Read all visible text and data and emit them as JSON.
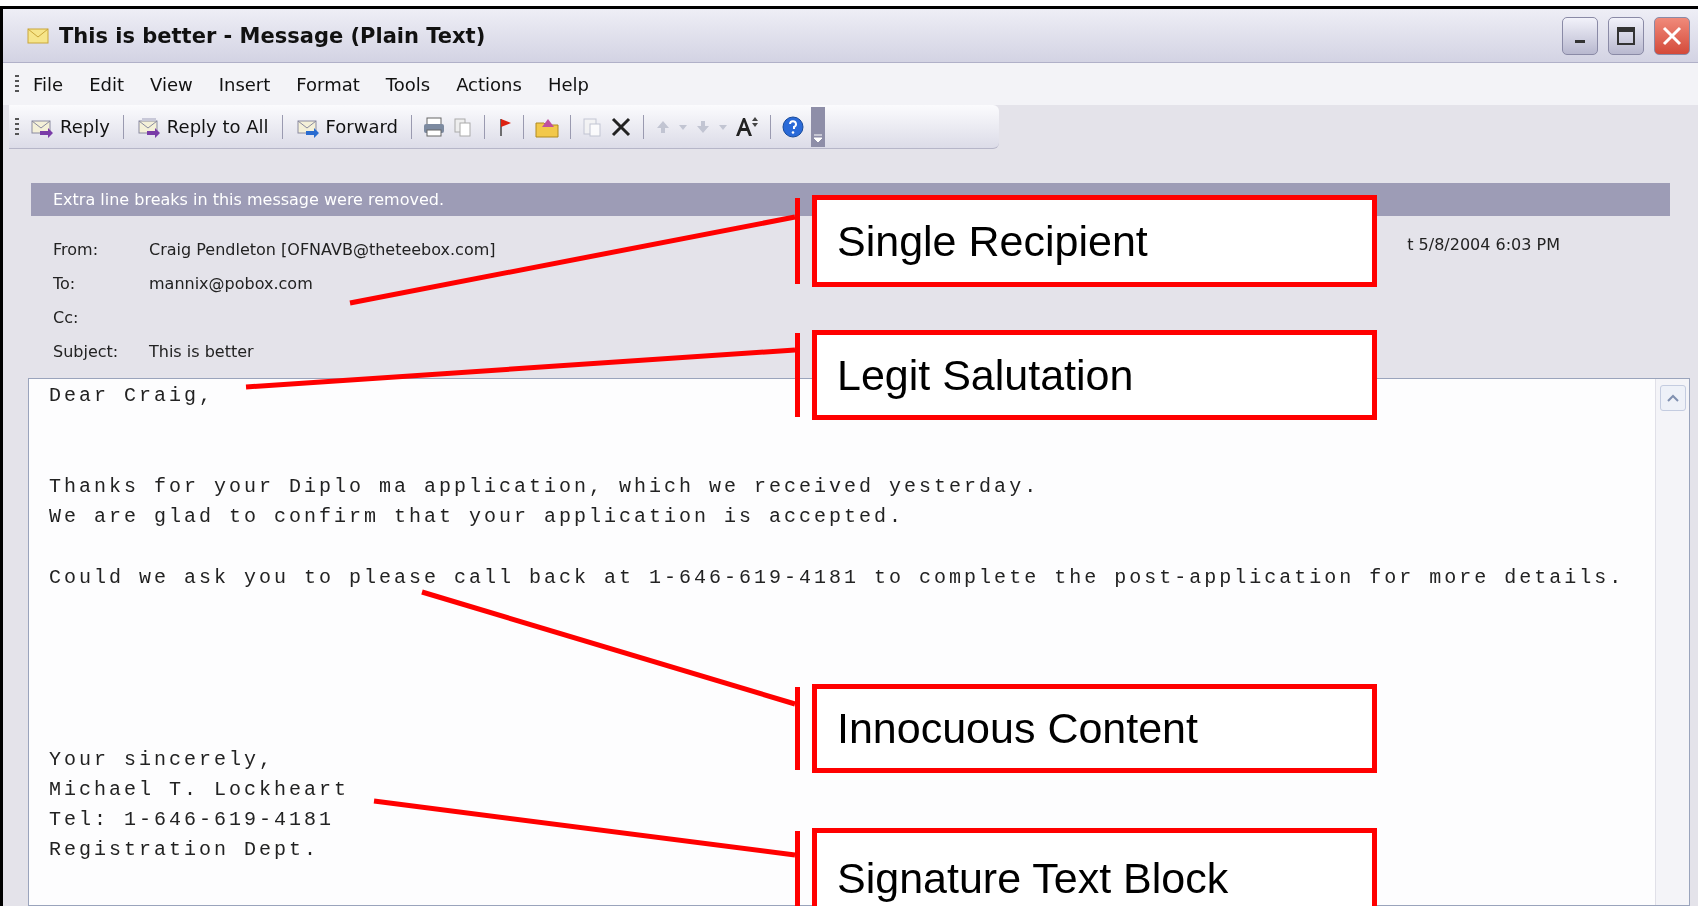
{
  "window": {
    "title": "This is better - Message (Plain Text)"
  },
  "menu": [
    {
      "label": "File"
    },
    {
      "label": "Edit"
    },
    {
      "label": "View"
    },
    {
      "label": "Insert"
    },
    {
      "label": "Format"
    },
    {
      "label": "Tools"
    },
    {
      "label": "Actions"
    },
    {
      "label": "Help"
    }
  ],
  "toolbar": [
    {
      "kind": "reply",
      "label": "Reply"
    },
    {
      "kind": "separator"
    },
    {
      "kind": "replyall",
      "label": "Reply to All"
    },
    {
      "kind": "separator"
    },
    {
      "kind": "forward",
      "label": "Forward"
    },
    {
      "kind": "separator"
    },
    {
      "kind": "print"
    },
    {
      "kind": "copy"
    },
    {
      "kind": "separator"
    },
    {
      "kind": "flag"
    },
    {
      "kind": "separator"
    },
    {
      "kind": "move"
    },
    {
      "kind": "separator"
    },
    {
      "kind": "paste",
      "disabled": true
    },
    {
      "kind": "delete"
    },
    {
      "kind": "separator"
    },
    {
      "kind": "previous",
      "disabled": true
    },
    {
      "kind": "dropdown",
      "disabled": true
    },
    {
      "kind": "next",
      "disabled": true
    },
    {
      "kind": "dropdown",
      "disabled": true
    },
    {
      "kind": "fontsize"
    },
    {
      "kind": "separator"
    },
    {
      "kind": "help"
    },
    {
      "kind": "overflow"
    }
  ],
  "info_bar": "Extra line breaks in this message were removed.",
  "header": [
    {
      "label": "From:",
      "value": "Craig Pendleton [OFNAVB@theteebox.com]"
    },
    {
      "label": "To:",
      "value": "mannix@pobox.com"
    },
    {
      "label": "Cc:"
    },
    {
      "label": "Subject:",
      "value": "This is better"
    }
  ],
  "sent": "t 5/8/2004 6:03 PM",
  "body": "Dear Craig,\n\n\nThanks for your Diplo ma application, which we received yesterday.\nWe are glad to confirm that your application is accepted.\n\nCould we ask you to please call back at 1-646-619-4181 to complete the post-application for more details.\n\n\n\n\n\nYour sincerely,\nMichael T. Lockheart\nTel: 1-646-619-4181\nRegistration Dept.",
  "callouts": [
    {
      "label": "Single Recipient"
    },
    {
      "label": "Legit Salutation"
    },
    {
      "label": "Innocuous Content"
    },
    {
      "label": "Signature Text Block"
    }
  ]
}
